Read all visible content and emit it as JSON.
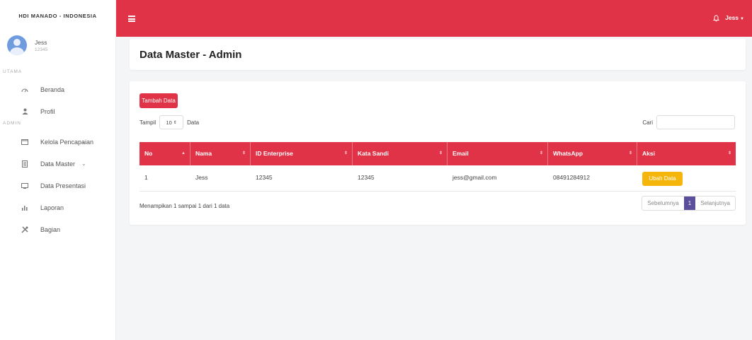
{
  "sidebar": {
    "brand": "HDI MANADO - INDONESIA",
    "user": {
      "name": "Jess",
      "id": "12345"
    },
    "sections": {
      "utama": "UTAMA",
      "admin": "ADMIN"
    },
    "items": [
      {
        "label": "Beranda",
        "icon": "gauge-icon"
      },
      {
        "label": "Profil",
        "icon": "user-icon"
      },
      {
        "label": "Kelola Pencapaian",
        "icon": "folder-icon",
        "expandable": true
      },
      {
        "label": "Data Master",
        "icon": "document-icon",
        "expandable": true
      },
      {
        "label": "Data Presentasi",
        "icon": "monitor-icon"
      },
      {
        "label": "Laporan",
        "icon": "bar-chart-icon"
      },
      {
        "label": "Bagian",
        "icon": "tools-icon"
      }
    ]
  },
  "topbar": {
    "user": "Jess",
    "menu_icon": "hamburger-icon",
    "notification_icon": "bell-icon",
    "color": "#e03347"
  },
  "page": {
    "title": "Data Master - Admin"
  },
  "toolbar": {
    "add_label": "Tambah Data",
    "show_prefix": "Tampil",
    "show_value": "10",
    "show_suffix": "Data",
    "search_label": "Cari",
    "search_value": ""
  },
  "table": {
    "columns": [
      "No",
      "Nama",
      "ID Enterprise",
      "Kata Sandi",
      "Email",
      "WhatsApp",
      "Aksi"
    ],
    "rows": [
      {
        "no": "1",
        "nama": "Jess",
        "id_enterprise": "12345",
        "kata_sandi": "12345",
        "email": "jess@gmail.com",
        "whatsapp": "08491284912",
        "action_label": "Ubah Data"
      }
    ]
  },
  "footer": {
    "info": "Menampikan 1 sampai 1 dari 1 data",
    "prev": "Sebelumnya",
    "page": "1",
    "next": "Selanjutnya"
  },
  "colors": {
    "primary": "#e03347",
    "warning": "#f5b50a",
    "pager_active": "#5b4f9c"
  }
}
